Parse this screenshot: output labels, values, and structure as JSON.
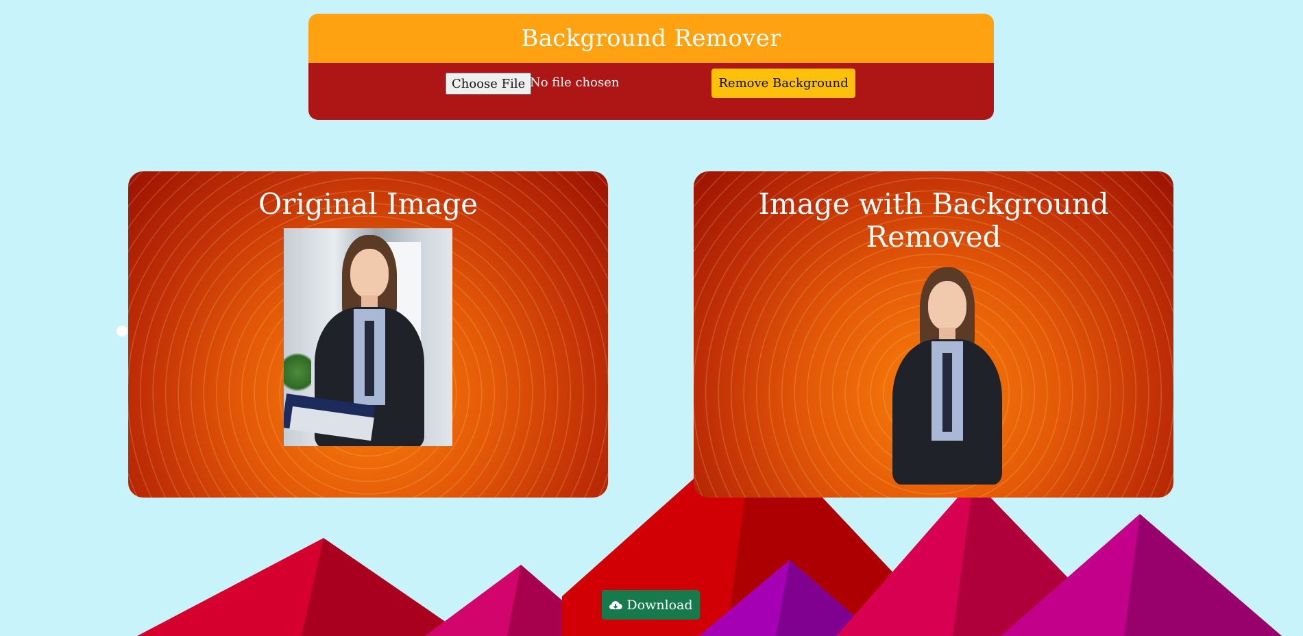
{
  "header": {
    "title": "Background Remover",
    "file_button_label": "Choose File",
    "file_status": "No file chosen",
    "remove_button_label": "Remove Background"
  },
  "cards": {
    "original_title": "Original Image",
    "result_title": "Image with Background Removed"
  },
  "actions": {
    "download_label": "Download",
    "download_icon": "cloud-download-icon"
  },
  "colors": {
    "page_background": "#c8f3fb",
    "header_title_bar": "#fea212",
    "header_controls_bar": "#ae1616",
    "remove_button": "#fec00b",
    "download_button": "#167a4c"
  }
}
